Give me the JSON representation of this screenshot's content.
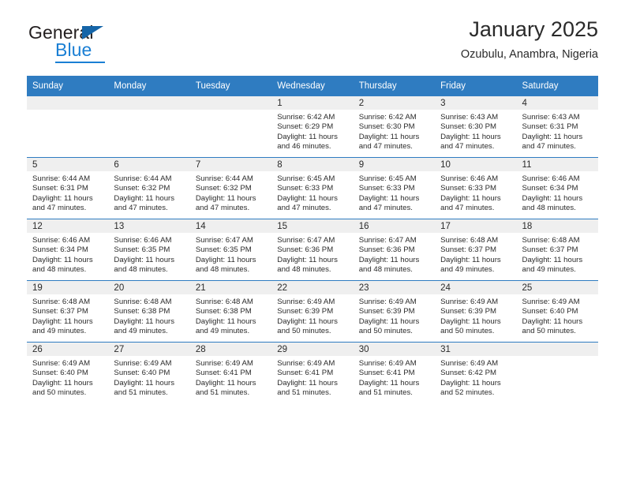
{
  "brand": {
    "name_top": "General",
    "name_bottom": "Blue",
    "triangle_color": "#1565a8",
    "blue_color": "#1a7fd4"
  },
  "header": {
    "title": "January 2025",
    "subtitle": "Ozubulu, Anambra, Nigeria"
  },
  "theme": {
    "header_bg": "#2f7cc1",
    "daynum_bg": "#efefef",
    "text": "#2b2b2b"
  },
  "weekdays": [
    "Sunday",
    "Monday",
    "Tuesday",
    "Wednesday",
    "Thursday",
    "Friday",
    "Saturday"
  ],
  "weeks": [
    [
      {
        "day": "",
        "sunrise": "",
        "sunset": "",
        "daylight_line1": "",
        "daylight_line2": "",
        "empty": true
      },
      {
        "day": "",
        "sunrise": "",
        "sunset": "",
        "daylight_line1": "",
        "daylight_line2": "",
        "empty": true
      },
      {
        "day": "",
        "sunrise": "",
        "sunset": "",
        "daylight_line1": "",
        "daylight_line2": "",
        "empty": true
      },
      {
        "day": "1",
        "sunrise": "Sunrise: 6:42 AM",
        "sunset": "Sunset: 6:29 PM",
        "daylight_line1": "Daylight: 11 hours",
        "daylight_line2": "and 46 minutes.",
        "empty": false
      },
      {
        "day": "2",
        "sunrise": "Sunrise: 6:42 AM",
        "sunset": "Sunset: 6:30 PM",
        "daylight_line1": "Daylight: 11 hours",
        "daylight_line2": "and 47 minutes.",
        "empty": false
      },
      {
        "day": "3",
        "sunrise": "Sunrise: 6:43 AM",
        "sunset": "Sunset: 6:30 PM",
        "daylight_line1": "Daylight: 11 hours",
        "daylight_line2": "and 47 minutes.",
        "empty": false
      },
      {
        "day": "4",
        "sunrise": "Sunrise: 6:43 AM",
        "sunset": "Sunset: 6:31 PM",
        "daylight_line1": "Daylight: 11 hours",
        "daylight_line2": "and 47 minutes.",
        "empty": false
      }
    ],
    [
      {
        "day": "5",
        "sunrise": "Sunrise: 6:44 AM",
        "sunset": "Sunset: 6:31 PM",
        "daylight_line1": "Daylight: 11 hours",
        "daylight_line2": "and 47 minutes.",
        "empty": false
      },
      {
        "day": "6",
        "sunrise": "Sunrise: 6:44 AM",
        "sunset": "Sunset: 6:32 PM",
        "daylight_line1": "Daylight: 11 hours",
        "daylight_line2": "and 47 minutes.",
        "empty": false
      },
      {
        "day": "7",
        "sunrise": "Sunrise: 6:44 AM",
        "sunset": "Sunset: 6:32 PM",
        "daylight_line1": "Daylight: 11 hours",
        "daylight_line2": "and 47 minutes.",
        "empty": false
      },
      {
        "day": "8",
        "sunrise": "Sunrise: 6:45 AM",
        "sunset": "Sunset: 6:33 PM",
        "daylight_line1": "Daylight: 11 hours",
        "daylight_line2": "and 47 minutes.",
        "empty": false
      },
      {
        "day": "9",
        "sunrise": "Sunrise: 6:45 AM",
        "sunset": "Sunset: 6:33 PM",
        "daylight_line1": "Daylight: 11 hours",
        "daylight_line2": "and 47 minutes.",
        "empty": false
      },
      {
        "day": "10",
        "sunrise": "Sunrise: 6:46 AM",
        "sunset": "Sunset: 6:33 PM",
        "daylight_line1": "Daylight: 11 hours",
        "daylight_line2": "and 47 minutes.",
        "empty": false
      },
      {
        "day": "11",
        "sunrise": "Sunrise: 6:46 AM",
        "sunset": "Sunset: 6:34 PM",
        "daylight_line1": "Daylight: 11 hours",
        "daylight_line2": "and 48 minutes.",
        "empty": false
      }
    ],
    [
      {
        "day": "12",
        "sunrise": "Sunrise: 6:46 AM",
        "sunset": "Sunset: 6:34 PM",
        "daylight_line1": "Daylight: 11 hours",
        "daylight_line2": "and 48 minutes.",
        "empty": false
      },
      {
        "day": "13",
        "sunrise": "Sunrise: 6:46 AM",
        "sunset": "Sunset: 6:35 PM",
        "daylight_line1": "Daylight: 11 hours",
        "daylight_line2": "and 48 minutes.",
        "empty": false
      },
      {
        "day": "14",
        "sunrise": "Sunrise: 6:47 AM",
        "sunset": "Sunset: 6:35 PM",
        "daylight_line1": "Daylight: 11 hours",
        "daylight_line2": "and 48 minutes.",
        "empty": false
      },
      {
        "day": "15",
        "sunrise": "Sunrise: 6:47 AM",
        "sunset": "Sunset: 6:36 PM",
        "daylight_line1": "Daylight: 11 hours",
        "daylight_line2": "and 48 minutes.",
        "empty": false
      },
      {
        "day": "16",
        "sunrise": "Sunrise: 6:47 AM",
        "sunset": "Sunset: 6:36 PM",
        "daylight_line1": "Daylight: 11 hours",
        "daylight_line2": "and 48 minutes.",
        "empty": false
      },
      {
        "day": "17",
        "sunrise": "Sunrise: 6:48 AM",
        "sunset": "Sunset: 6:37 PM",
        "daylight_line1": "Daylight: 11 hours",
        "daylight_line2": "and 49 minutes.",
        "empty": false
      },
      {
        "day": "18",
        "sunrise": "Sunrise: 6:48 AM",
        "sunset": "Sunset: 6:37 PM",
        "daylight_line1": "Daylight: 11 hours",
        "daylight_line2": "and 49 minutes.",
        "empty": false
      }
    ],
    [
      {
        "day": "19",
        "sunrise": "Sunrise: 6:48 AM",
        "sunset": "Sunset: 6:37 PM",
        "daylight_line1": "Daylight: 11 hours",
        "daylight_line2": "and 49 minutes.",
        "empty": false
      },
      {
        "day": "20",
        "sunrise": "Sunrise: 6:48 AM",
        "sunset": "Sunset: 6:38 PM",
        "daylight_line1": "Daylight: 11 hours",
        "daylight_line2": "and 49 minutes.",
        "empty": false
      },
      {
        "day": "21",
        "sunrise": "Sunrise: 6:48 AM",
        "sunset": "Sunset: 6:38 PM",
        "daylight_line1": "Daylight: 11 hours",
        "daylight_line2": "and 49 minutes.",
        "empty": false
      },
      {
        "day": "22",
        "sunrise": "Sunrise: 6:49 AM",
        "sunset": "Sunset: 6:39 PM",
        "daylight_line1": "Daylight: 11 hours",
        "daylight_line2": "and 50 minutes.",
        "empty": false
      },
      {
        "day": "23",
        "sunrise": "Sunrise: 6:49 AM",
        "sunset": "Sunset: 6:39 PM",
        "daylight_line1": "Daylight: 11 hours",
        "daylight_line2": "and 50 minutes.",
        "empty": false
      },
      {
        "day": "24",
        "sunrise": "Sunrise: 6:49 AM",
        "sunset": "Sunset: 6:39 PM",
        "daylight_line1": "Daylight: 11 hours",
        "daylight_line2": "and 50 minutes.",
        "empty": false
      },
      {
        "day": "25",
        "sunrise": "Sunrise: 6:49 AM",
        "sunset": "Sunset: 6:40 PM",
        "daylight_line1": "Daylight: 11 hours",
        "daylight_line2": "and 50 minutes.",
        "empty": false
      }
    ],
    [
      {
        "day": "26",
        "sunrise": "Sunrise: 6:49 AM",
        "sunset": "Sunset: 6:40 PM",
        "daylight_line1": "Daylight: 11 hours",
        "daylight_line2": "and 50 minutes.",
        "empty": false
      },
      {
        "day": "27",
        "sunrise": "Sunrise: 6:49 AM",
        "sunset": "Sunset: 6:40 PM",
        "daylight_line1": "Daylight: 11 hours",
        "daylight_line2": "and 51 minutes.",
        "empty": false
      },
      {
        "day": "28",
        "sunrise": "Sunrise: 6:49 AM",
        "sunset": "Sunset: 6:41 PM",
        "daylight_line1": "Daylight: 11 hours",
        "daylight_line2": "and 51 minutes.",
        "empty": false
      },
      {
        "day": "29",
        "sunrise": "Sunrise: 6:49 AM",
        "sunset": "Sunset: 6:41 PM",
        "daylight_line1": "Daylight: 11 hours",
        "daylight_line2": "and 51 minutes.",
        "empty": false
      },
      {
        "day": "30",
        "sunrise": "Sunrise: 6:49 AM",
        "sunset": "Sunset: 6:41 PM",
        "daylight_line1": "Daylight: 11 hours",
        "daylight_line2": "and 51 minutes.",
        "empty": false
      },
      {
        "day": "31",
        "sunrise": "Sunrise: 6:49 AM",
        "sunset": "Sunset: 6:42 PM",
        "daylight_line1": "Daylight: 11 hours",
        "daylight_line2": "and 52 minutes.",
        "empty": false
      },
      {
        "day": "",
        "sunrise": "",
        "sunset": "",
        "daylight_line1": "",
        "daylight_line2": "",
        "empty": true
      }
    ]
  ]
}
